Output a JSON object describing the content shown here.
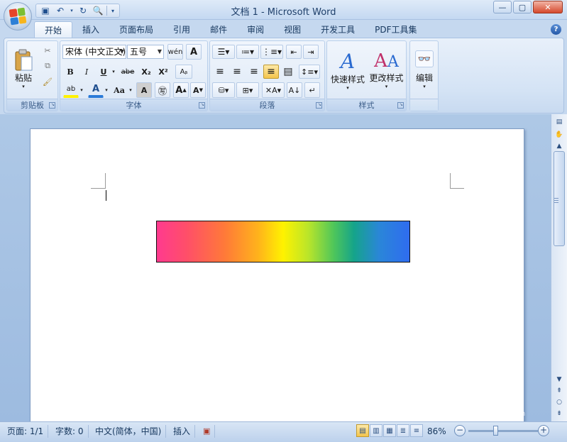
{
  "window": {
    "title": "文档 1 - Microsoft Word"
  },
  "quick_access": {
    "save_icon": "save-icon",
    "undo_icon": "undo-icon",
    "redo_icon": "redo-icon",
    "print_preview_icon": "print-preview-icon"
  },
  "tabs": [
    {
      "label": "开始",
      "active": true
    },
    {
      "label": "插入"
    },
    {
      "label": "页面布局"
    },
    {
      "label": "引用"
    },
    {
      "label": "邮件"
    },
    {
      "label": "审阅"
    },
    {
      "label": "视图"
    },
    {
      "label": "开发工具"
    },
    {
      "label": "PDF工具集"
    }
  ],
  "ribbon": {
    "clipboard": {
      "label": "剪贴板",
      "paste_label": "粘贴"
    },
    "font": {
      "label": "字体",
      "font_name": "宋体 (中文正文)",
      "font_size": "五号",
      "bold": "B",
      "italic": "I",
      "underline": "U",
      "strike": "abe",
      "subscript": "X₂",
      "superscript": "X²",
      "grow": "A",
      "shrink": "A",
      "change_case": "Aa"
    },
    "paragraph": {
      "label": "段落"
    },
    "styles": {
      "label": "样式",
      "quick_styles": "快速样式",
      "change_styles": "更改样式"
    },
    "editing": {
      "label": "编辑"
    }
  },
  "document": {
    "gradient_colors": [
      "#ff3a8f",
      "#ff7a38",
      "#fff200",
      "#4fc65a",
      "#15a48a",
      "#2f6cf0"
    ]
  },
  "statusbar": {
    "page": "页面: 1/1",
    "words": "字数: 0",
    "language": "中文(简体，中国)",
    "mode": "插入",
    "zoom": "86%"
  },
  "watermark": {
    "text": "Bai 经验",
    "sub": "jingyan.baidu.com"
  }
}
